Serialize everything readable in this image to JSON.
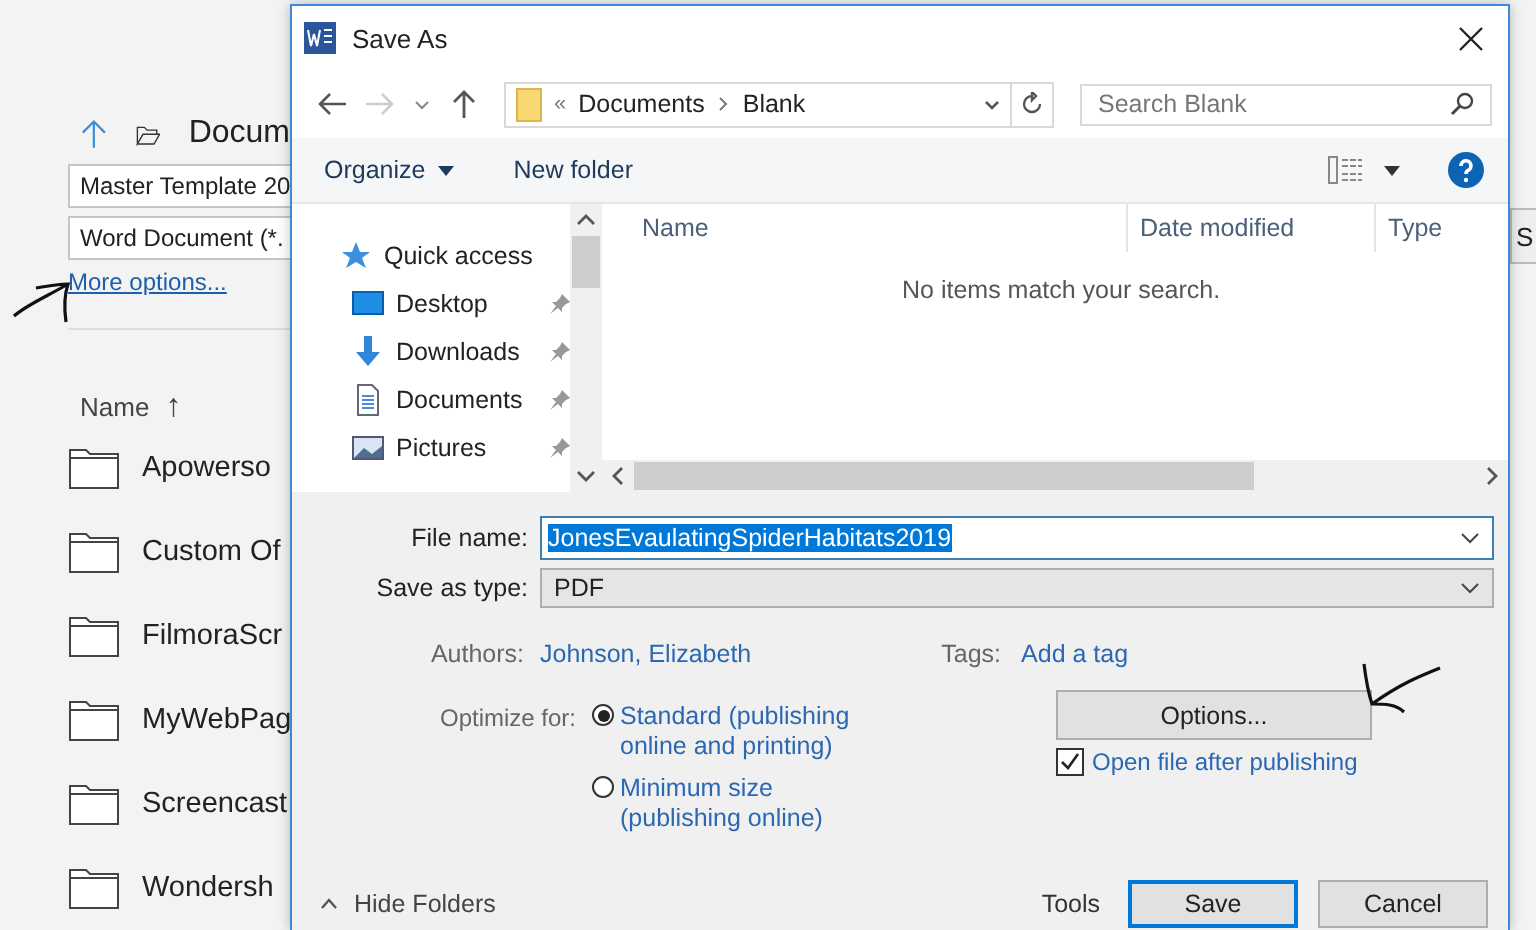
{
  "background": {
    "location": "Docum",
    "file_name": "Master Template 20",
    "file_type": "Word Document (*.",
    "more_options": "More options...",
    "name_header": "Name",
    "sort_arrow": "↑",
    "side_button": "S",
    "folders": [
      "Apowerso",
      "Custom Of",
      "FilmoraScr",
      "MyWebPag",
      "Screencast",
      "Wondersh"
    ]
  },
  "dialog": {
    "title": "Save As",
    "address": {
      "prefix": "«",
      "segments": [
        "Documents",
        "Blank"
      ]
    },
    "search": {
      "placeholder": "Search Blank"
    },
    "toolbar": {
      "organize": "Organize",
      "new_folder": "New folder"
    },
    "nav": [
      {
        "label": "Quick access",
        "kind": "star",
        "pinned": false
      },
      {
        "label": "Desktop",
        "kind": "desktop",
        "pinned": true
      },
      {
        "label": "Downloads",
        "kind": "download",
        "pinned": true
      },
      {
        "label": "Documents",
        "kind": "document",
        "pinned": true
      },
      {
        "label": "Pictures",
        "kind": "picture",
        "pinned": true
      }
    ],
    "columns": [
      "Name",
      "Date modified",
      "Type"
    ],
    "empty_message": "No items match your search.",
    "file_name_label": "File name:",
    "file_name": "JonesEvaulatingSpiderHabitats2019",
    "type_label": "Save as type:",
    "save_as_type": "PDF",
    "authors_label": "Authors:",
    "authors": "Johnson, Elizabeth",
    "tags_label": "Tags:",
    "tags": "Add a tag",
    "optimize_label": "Optimize for:",
    "optimize_options": [
      {
        "label": "Standard (publishing online and printing)",
        "selected": true
      },
      {
        "label": "Minimum size (publishing online)",
        "selected": false
      }
    ],
    "options_button": "Options...",
    "open_after": {
      "label": "Open file after publishing",
      "checked": true
    },
    "hide_folders": "Hide Folders",
    "tools": "Tools",
    "buttons": [
      "Save",
      "Cancel"
    ]
  }
}
